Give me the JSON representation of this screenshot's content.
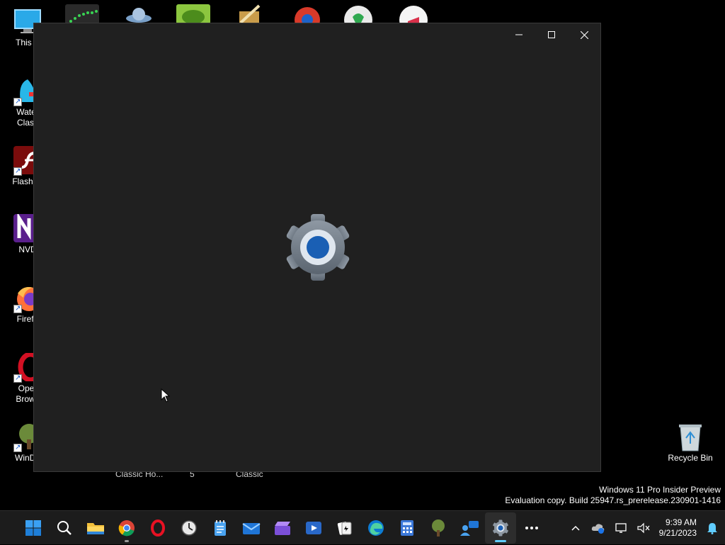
{
  "desktop": {
    "left_icons": [
      {
        "label": "This P",
        "name": "this-pc-icon",
        "color": "#2aa9e8"
      },
      {
        "label": "Water\nClass",
        "name": "watercolor-classic-icon",
        "color": "#29b7e8"
      },
      {
        "label": "Flash Pl",
        "name": "flash-player-icon",
        "color": "#8b1111"
      },
      {
        "label": "NVD",
        "name": "nvda-icon",
        "color": "#5a1f8c"
      },
      {
        "label": "Firefo",
        "name": "firefox-icon",
        "color": "#e8621a"
      },
      {
        "label": "Oper\nBrows",
        "name": "opera-browser-icon",
        "color": "#d21023"
      },
      {
        "label": "WinDir",
        "name": "windirstat-icon",
        "color": "#6b8a3a"
      }
    ],
    "partial_labels": [
      "Classic Ho...",
      "5",
      "Classic"
    ],
    "recycle_bin": {
      "label": "Recycle Bin"
    }
  },
  "window": {
    "controls": {
      "minimize": "–",
      "maximize": "□",
      "close": "✕"
    },
    "splash_icon": "settings-gear-icon",
    "accent_color": "#1a5fb4"
  },
  "watermark": {
    "line1": "Windows 11 Pro Insider Preview",
    "line2": "Evaluation copy. Build 25947.rs_prerelease.230901-1416"
  },
  "taskbar": {
    "apps": [
      {
        "name": "start-button",
        "icon": "windows-logo-icon"
      },
      {
        "name": "search-button",
        "icon": "search-icon"
      },
      {
        "name": "file-explorer-button",
        "icon": "folder-icon"
      },
      {
        "name": "chrome-button",
        "icon": "chrome-icon"
      },
      {
        "name": "opera-button",
        "icon": "opera-icon"
      },
      {
        "name": "clock-app-button",
        "icon": "clock-icon"
      },
      {
        "name": "notepad-button",
        "icon": "notepad-icon"
      },
      {
        "name": "mail-button",
        "icon": "mail-icon"
      },
      {
        "name": "clipchamp-button",
        "icon": "clapper-icon"
      },
      {
        "name": "media-player-button",
        "icon": "media-player-icon"
      },
      {
        "name": "solitaire-button",
        "icon": "cards-icon"
      },
      {
        "name": "edge-button",
        "icon": "edge-icon"
      },
      {
        "name": "calculator-button",
        "icon": "calculator-icon"
      },
      {
        "name": "windirstat-button",
        "icon": "tree-icon"
      },
      {
        "name": "quick-assist-button",
        "icon": "quick-assist-icon"
      },
      {
        "name": "settings-button",
        "icon": "gear-icon"
      },
      {
        "name": "more-apps-button",
        "icon": "ellipsis-icon"
      }
    ],
    "time": "9:39 AM",
    "date": "9/21/2023"
  }
}
